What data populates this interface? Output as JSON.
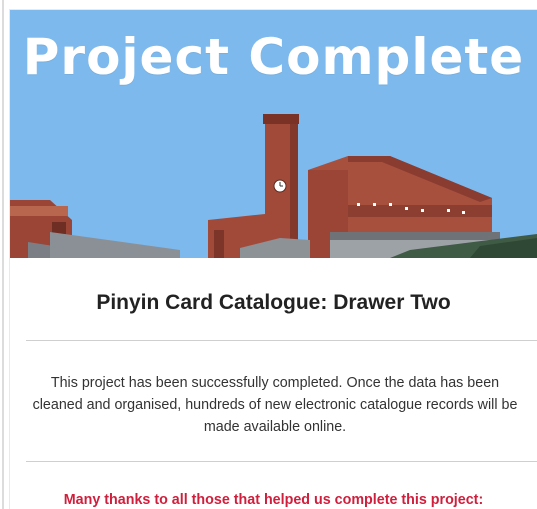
{
  "banner": {
    "title": "Project Complete",
    "sky_color": "#7db9ec",
    "brick_color": "#a24a3a"
  },
  "project": {
    "title": "Pinyin Card Catalogue: Drawer Two",
    "description": "This project has been successfully completed. Once the data has been cleaned and organised, hundreds of new electronic catalogue records will be made available online.",
    "thanks": "Many thanks to all those that helped us complete this project:"
  },
  "colors": {
    "thanks": "#d01f3c",
    "divider": "#cfcfcf"
  }
}
